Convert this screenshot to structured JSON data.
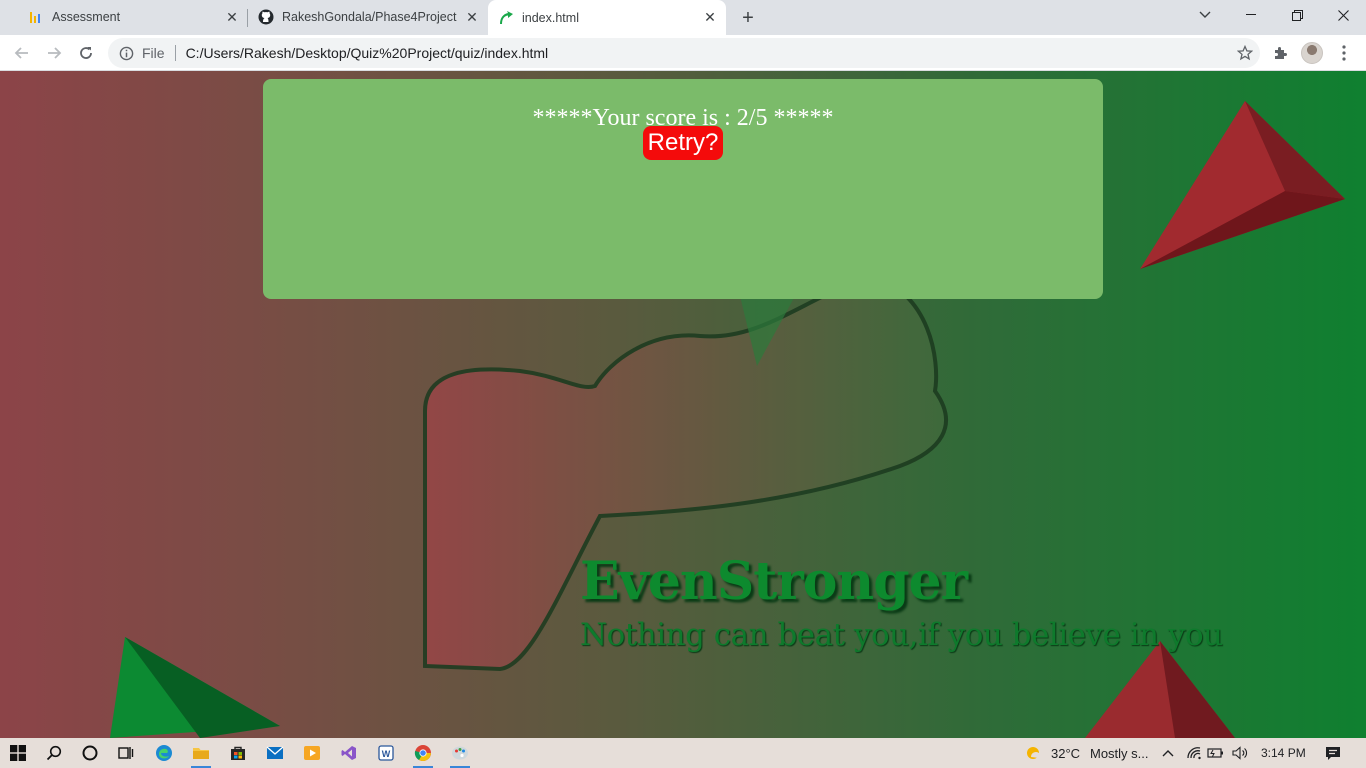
{
  "browser": {
    "tabs": [
      {
        "title": "Assessment",
        "favicon": "chart-bars-icon"
      },
      {
        "title": "RakeshGondala/Phase4Project",
        "favicon": "github-icon"
      },
      {
        "title": "index.html",
        "favicon": "leaf-arrow-icon",
        "active": true
      }
    ],
    "address": {
      "scheme_label": "File",
      "url": "C:/Users/Rakesh/Desktop/Quiz%20Project/quiz/index.html"
    }
  },
  "page": {
    "score_text": "*****Your score is : 2/5 *****",
    "retry_label": "Retry?",
    "brand_name": "EvenStronger",
    "tagline": "Nothing can beat you,if you believe in you",
    "colors": {
      "card": "#7bbb6a",
      "retry_button": "#f40b0b",
      "brand_green": "#0d8a2e"
    }
  },
  "taskbar": {
    "weather": "32°C",
    "weather_desc": "Mostly s...",
    "time": "3:14 PM"
  }
}
